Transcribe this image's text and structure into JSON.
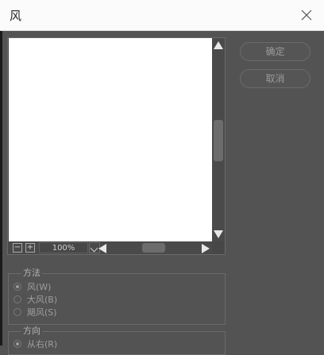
{
  "window": {
    "title": "风"
  },
  "buttons": {
    "ok": "确定",
    "cancel": "取消"
  },
  "preview": {
    "zoom": "100%"
  },
  "method": {
    "label": "方法",
    "options": [
      {
        "label": "风(W)",
        "selected": true
      },
      {
        "label": "大风(B)",
        "selected": false
      },
      {
        "label": "飓风(S)",
        "selected": false
      }
    ]
  },
  "direction": {
    "label": "方向",
    "options": [
      {
        "label": "从右(R)",
        "selected": true
      }
    ]
  },
  "icons": [
    "close-icon",
    "zoom-out-icon",
    "zoom-in-icon",
    "chevron-down-icon",
    "arrow-up-icon",
    "arrow-down-icon",
    "arrow-left-icon",
    "arrow-right-icon"
  ],
  "colors": {
    "dialog_bg": "#535353",
    "titlebar_bg": "#fbfbfb",
    "canvas": "#ffffff"
  }
}
